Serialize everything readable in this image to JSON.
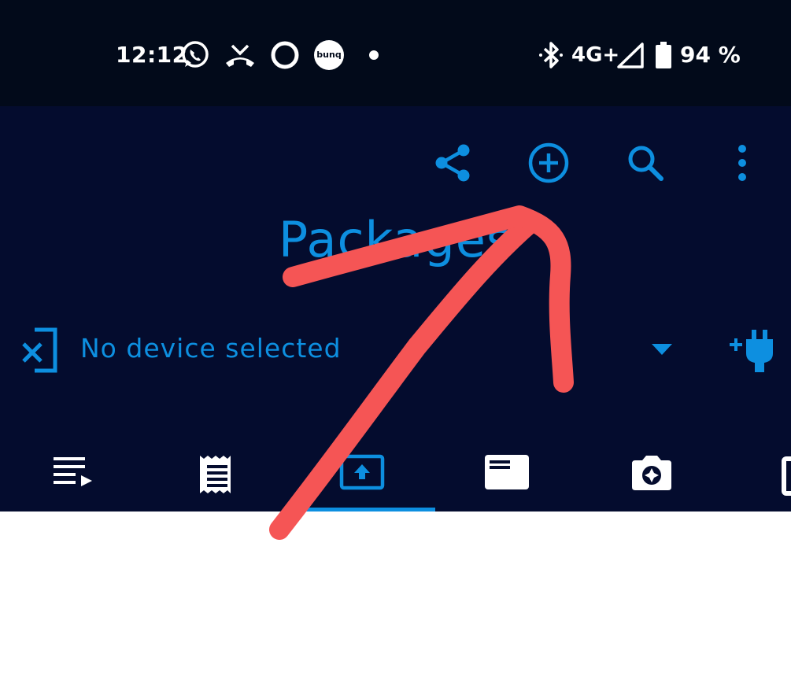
{
  "status_bar": {
    "time": "12:12",
    "bunq_label": "bunq",
    "network": "4G+",
    "battery": "94 %"
  },
  "app_bar": {
    "title": "Packages",
    "actions": [
      "share-icon",
      "add-circle-icon",
      "search-icon",
      "more-vert-icon"
    ]
  },
  "device": {
    "label": "No device selected"
  },
  "tabs": {
    "items": [
      "queue-icon",
      "receipt-icon",
      "upload-icon",
      "card-icon",
      "camera-icon",
      "more-tab-icon"
    ],
    "selected_index": 2
  },
  "colors": {
    "status_bg": "#020a1a",
    "appbar_bg": "#040c2e",
    "accent": "#0d8fe0",
    "annotation": "#f55555"
  }
}
